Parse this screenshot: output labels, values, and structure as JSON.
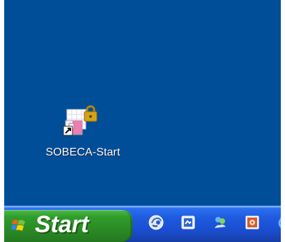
{
  "desktop": {
    "background_color": "#004e98",
    "icons": [
      {
        "label": "SOBECA-Start",
        "icon": "shortcut-lock-spreadsheet-icon"
      }
    ]
  },
  "taskbar": {
    "start_label": "Start",
    "start_color": "#2f9d2b",
    "bar_color": "#1f59dd",
    "quick_launch": [
      {
        "icon": "browser-icon"
      },
      {
        "icon": "desktop-icon"
      },
      {
        "icon": "messenger-icon"
      },
      {
        "icon": "media-player-icon"
      },
      {
        "icon": "internet-explorer-icon"
      }
    ]
  }
}
